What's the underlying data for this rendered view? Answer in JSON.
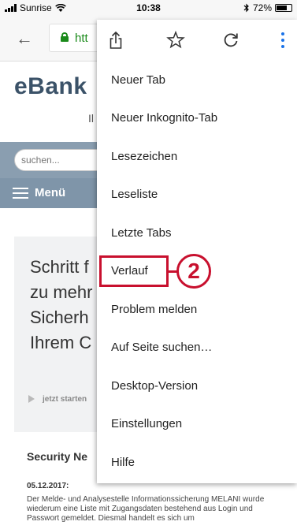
{
  "status_bar": {
    "carrier": "Sunrise",
    "time": "10:38",
    "battery": "72%",
    "battery_level": 0.72
  },
  "browser": {
    "url": "htt"
  },
  "page": {
    "logo": "eBank",
    "logo_sub": "Il",
    "search": {
      "placeholder": "suchen..."
    },
    "menu_label": "Menü",
    "hero_lines": [
      "Schritt f",
      "zu mehr",
      "Sicherh",
      "Ihrem C"
    ],
    "hero_cta": "jetzt starten",
    "section_title": "Security Ne",
    "news": {
      "date": "05.12.2017:",
      "body": "Der Melde- und Analysestelle Informationssicherung MELANI wurde wiederum eine Liste mit Zugangsdaten bestehend aus Login und Passwort gemeldet. Diesmal handelt es sich um"
    }
  },
  "menu": {
    "icons": [
      "share-icon",
      "star-icon",
      "reload-icon",
      "more-vertical-icon"
    ],
    "items": [
      "Neuer Tab",
      "Neuer Inkognito-Tab",
      "Lesezeichen",
      "Leseliste",
      "Letzte Tabs",
      "Verlauf",
      "Problem melden",
      "Auf Seite suchen…",
      "Desktop-Version",
      "Einstellungen",
      "Hilfe"
    ]
  },
  "annotation": {
    "step": "2",
    "color": "#c8102e"
  }
}
